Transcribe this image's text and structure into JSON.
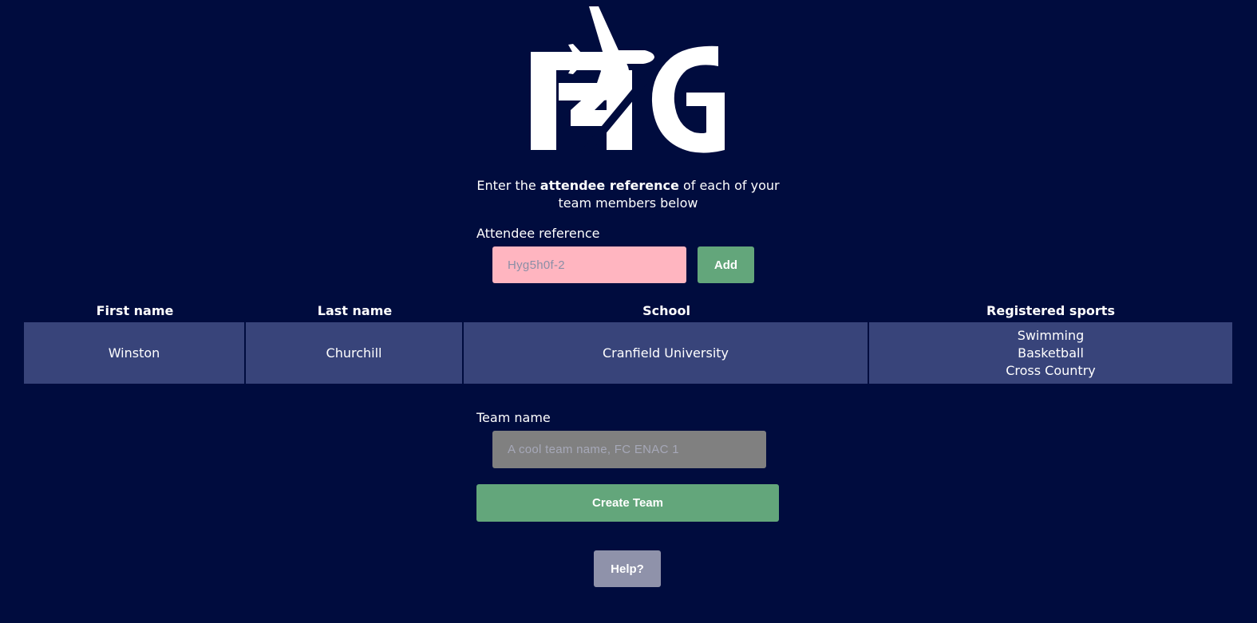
{
  "intro": {
    "prefix": "Enter the ",
    "bold": "attendee reference",
    "suffix": " of each of your team members below"
  },
  "attendee_form": {
    "label": "Attendee reference",
    "placeholder": "Hyg5h0f-2",
    "add_label": "Add",
    "input_color": "#ffb5c0"
  },
  "table": {
    "headers": [
      "First name",
      "Last name",
      "School",
      "Registered sports"
    ],
    "rows": [
      {
        "first_name": "Winston",
        "last_name": "Churchill",
        "school": "Cranfield University",
        "sports": [
          "Swimming",
          "Basketball",
          "Cross Country"
        ]
      }
    ]
  },
  "team_form": {
    "label": "Team name",
    "placeholder": "A cool team name, FC ENAC 1",
    "create_label": "Create Team"
  },
  "help_label": "Help?",
  "colors": {
    "background": "#000c3e",
    "row_bg": "#38447a",
    "button_green": "#63a67b",
    "help_button": "#8f92aa",
    "team_input": "#808080"
  }
}
